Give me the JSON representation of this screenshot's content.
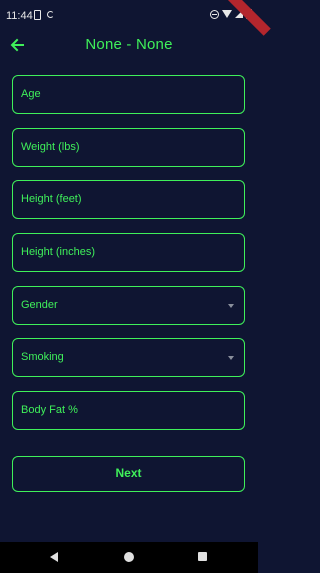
{
  "status_bar": {
    "time": "11:44"
  },
  "app_bar": {
    "title": "None - None",
    "back_icon": "arrow-back-icon"
  },
  "form": {
    "fields": [
      {
        "label": "Age"
      },
      {
        "label": "Weight (lbs)"
      },
      {
        "label": "Height (feet)"
      },
      {
        "label": "Height (inches)"
      },
      {
        "label": "Gender"
      },
      {
        "label": "Smoking"
      },
      {
        "label": "Body Fat %"
      }
    ],
    "next_label": "Next"
  },
  "colors": {
    "accent": "#3ff05a",
    "background": "#0f1532"
  }
}
